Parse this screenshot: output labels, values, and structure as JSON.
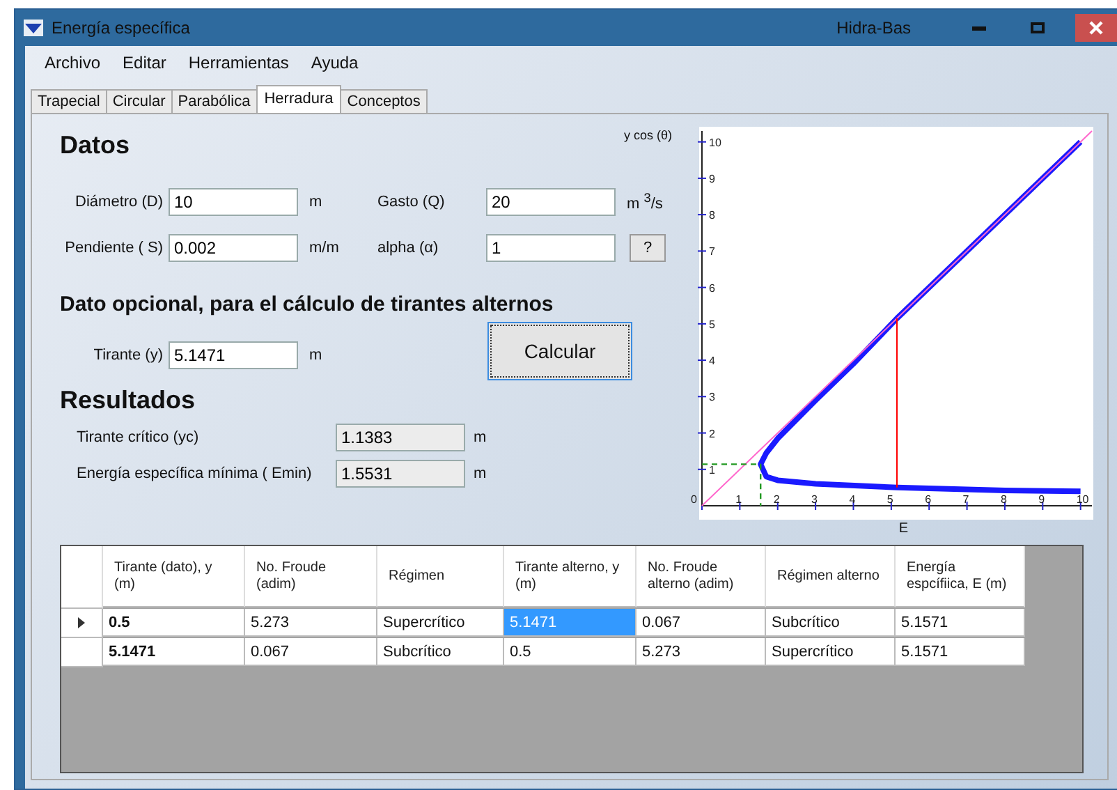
{
  "window": {
    "title": "Energía específica",
    "app_name": "Hidra-Bas"
  },
  "menu": [
    "Archivo",
    "Editar",
    "Herramientas",
    "Ayuda"
  ],
  "tabs": [
    {
      "label": "Trapecial",
      "selected": false
    },
    {
      "label": "Circular",
      "selected": false
    },
    {
      "label": "Parabólica",
      "selected": false
    },
    {
      "label": "Herradura",
      "selected": true
    },
    {
      "label": "Conceptos",
      "selected": false
    }
  ],
  "datos": {
    "heading": "Datos",
    "fields": [
      {
        "label": "Diámetro (D)",
        "value": "10",
        "unit": "m"
      },
      {
        "label": "Gasto (Q)",
        "value": "20",
        "unit": "m $^{3}$/s"
      },
      {
        "label": "Pendiente ( S)",
        "value": "0.002",
        "unit": "m/m"
      },
      {
        "label": "alpha (α)",
        "value": "1",
        "help_button": "?"
      }
    ]
  },
  "opcional": {
    "heading": "Dato opcional, para el cálculo de tirantes alternos",
    "label": "Tirante (y)",
    "value": "5.1471",
    "unit": "m",
    "button": "Calcular"
  },
  "resultados": {
    "heading": "Resultados",
    "fields": [
      {
        "label": "Tirante crítico (yc)",
        "value": "1.1383",
        "unit": "m"
      },
      {
        "label": "Energía específica mínima ( Emin)",
        "value": "1.5531",
        "unit": "m"
      }
    ]
  },
  "chart": {
    "chart_data": {
      "type": "line",
      "xlabel": "E",
      "ylabel": "y cos (θ)",
      "xlim": [
        0,
        10.3
      ],
      "ylim": [
        0,
        10.3
      ],
      "xticks": [
        {
          "value": 0,
          "label": "0"
        },
        1,
        2,
        3,
        4,
        5,
        6,
        7,
        8,
        9,
        10
      ],
      "yticks": [
        1,
        2,
        3,
        4,
        5,
        6,
        7,
        8,
        9,
        10
      ],
      "series": [
        {
          "color": "#1a1aff",
          "line_style": "solid",
          "x": [
            10,
            8,
            6,
            5.15,
            4,
            3,
            2,
            1.7,
            1.55,
            1.7,
            2,
            3,
            5.15,
            8,
            10
          ],
          "values": [
            10,
            8,
            6,
            5.15,
            3.9,
            2.9,
            1.85,
            1.45,
            1.14,
            0.8,
            0.7,
            0.6,
            0.5,
            0.42,
            0.4
          ]
        },
        {
          "color": "#ff66cc",
          "line_style": "solid",
          "x": [
            0,
            10.3
          ],
          "values": [
            0,
            10.3
          ]
        },
        {
          "color": "#ff0000",
          "line_style": "solid",
          "x": [
            5.15,
            5.15
          ],
          "values": [
            0.5,
            5.15
          ]
        },
        {
          "color": "#229922",
          "line_style": "dashed",
          "x": [
            0,
            1.55,
            1.55
          ],
          "values": [
            1.14,
            1.14,
            0
          ]
        }
      ]
    }
  },
  "table": {
    "columns": [
      "Tirante (dato), y (m)",
      "No. Froude (adim)",
      "Régimen",
      "Tirante alterno, y (m)",
      "No. Froude alterno (adim)",
      "Régimen alterno",
      "Energía espcífiica, E (m)"
    ],
    "rows": [
      {
        "current": true,
        "cells": [
          {
            "text": "0.5",
            "selected": false
          },
          {
            "text": "5.273",
            "selected": false
          },
          {
            "text": "Supercrítico",
            "selected": false
          },
          {
            "text": "5.1471",
            "selected": true
          },
          {
            "text": "0.067",
            "selected": false
          },
          {
            "text": "Subcrítico",
            "selected": false
          },
          {
            "text": "5.1571",
            "selected": false
          }
        ]
      },
      {
        "current": false,
        "cells": [
          {
            "text": "5.1471",
            "selected": false
          },
          {
            "text": "0.067",
            "selected": false
          },
          {
            "text": "Subcrítico",
            "selected": false
          },
          {
            "text": "0.5",
            "selected": false
          },
          {
            "text": "5.273",
            "selected": false
          },
          {
            "text": "Supercrítico",
            "selected": false
          },
          {
            "text": "5.1571",
            "selected": false
          }
        ]
      }
    ]
  }
}
